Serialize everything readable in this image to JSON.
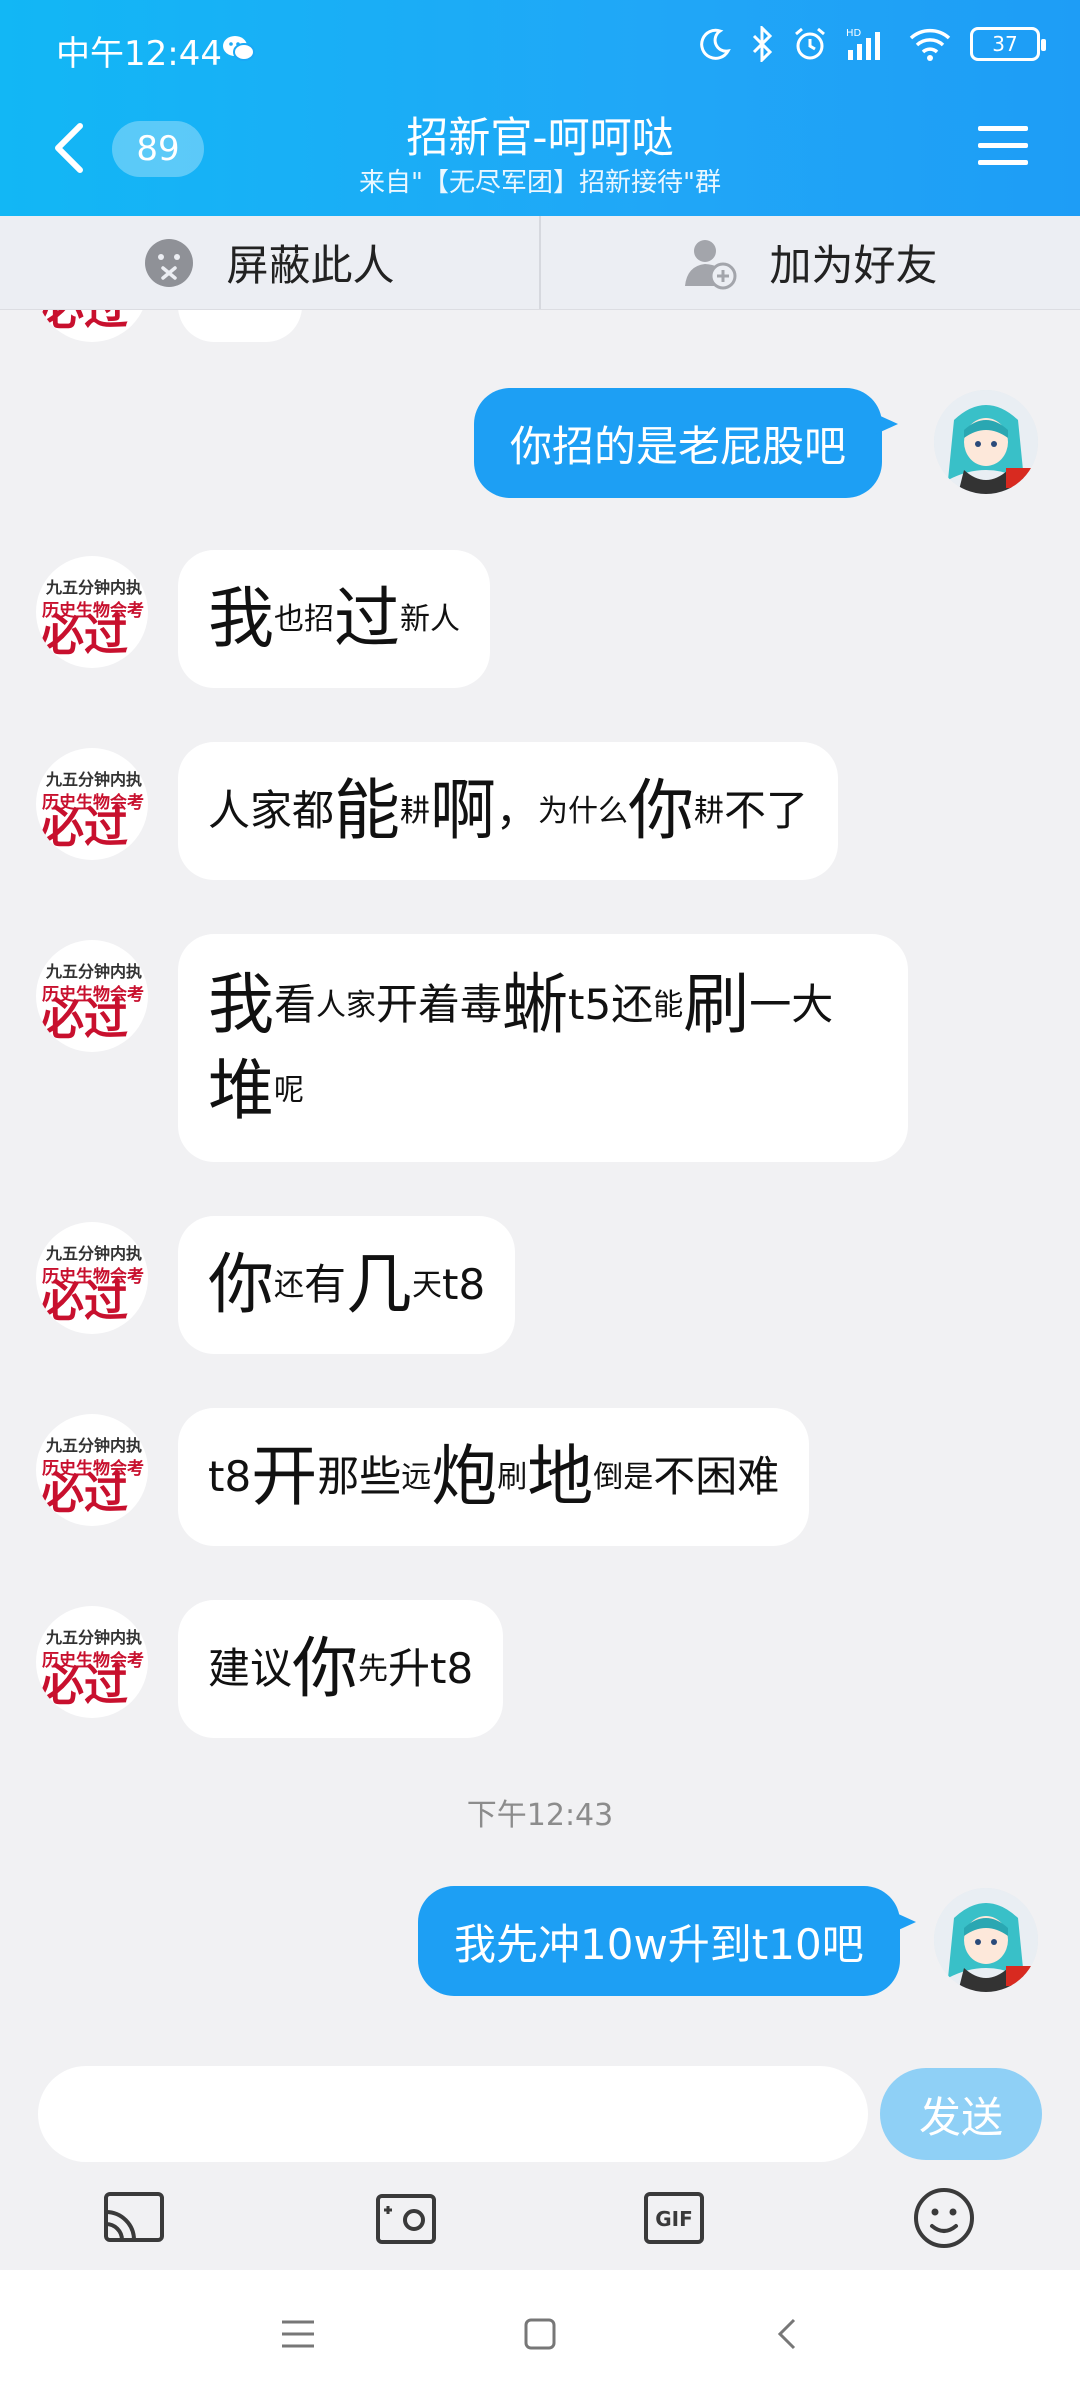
{
  "status_bar": {
    "time": "中午12:44",
    "battery": "37",
    "hd_label": "HD"
  },
  "header": {
    "unread_count": "89",
    "title": "招新官-呵呵哒",
    "subtitle": "来自\"【无尽军团】招新接待\"群"
  },
  "action_bar": {
    "block_label": "屏蔽此人",
    "add_friend_label": "加为好友"
  },
  "sender_avatar": {
    "line1": "九五分钟内执",
    "line2": "历史生物会考",
    "big": "必过"
  },
  "messages": [
    {
      "side": "out",
      "segments": [
        {
          "t": "你招的是老屁股吧",
          "s": "m"
        }
      ]
    },
    {
      "side": "in",
      "segments": [
        {
          "t": "我",
          "s": "b"
        },
        {
          "t": "也招",
          "s": "s"
        },
        {
          "t": "过",
          "s": "b"
        },
        {
          "t": "新人",
          "s": "s"
        }
      ]
    },
    {
      "side": "in",
      "segments": [
        {
          "t": "人家都",
          "s": "m"
        },
        {
          "t": "能",
          "s": "b"
        },
        {
          "t": "耕",
          "s": "s"
        },
        {
          "t": "啊",
          "s": "b"
        },
        {
          "t": "，",
          "s": "m"
        },
        {
          "t": "为什么",
          "s": "s"
        },
        {
          "t": "你",
          "s": "b"
        },
        {
          "t": "耕",
          "s": "s"
        },
        {
          "t": "不了",
          "s": "m"
        }
      ]
    },
    {
      "side": "in",
      "segments": [
        {
          "t": "我",
          "s": "b"
        },
        {
          "t": "看",
          "s": "m"
        },
        {
          "t": "人家",
          "s": "s"
        },
        {
          "t": "开着毒",
          "s": "m"
        },
        {
          "t": "蜥",
          "s": "b"
        },
        {
          "t": "t5还",
          "s": "m"
        },
        {
          "t": "能",
          "s": "s"
        },
        {
          "t": "刷",
          "s": "b"
        },
        {
          "t": "一大",
          "s": "m"
        },
        {
          "t": "堆",
          "s": "b"
        },
        {
          "t": "呢",
          "s": "s"
        }
      ]
    },
    {
      "side": "in",
      "segments": [
        {
          "t": "你",
          "s": "b"
        },
        {
          "t": "还",
          "s": "s"
        },
        {
          "t": "有",
          "s": "m"
        },
        {
          "t": "几",
          "s": "b"
        },
        {
          "t": "天",
          "s": "s"
        },
        {
          "t": "t8",
          "s": "m"
        }
      ]
    },
    {
      "side": "in",
      "segments": [
        {
          "t": "t8",
          "s": "m"
        },
        {
          "t": "开",
          "s": "b"
        },
        {
          "t": "那些",
          "s": "m"
        },
        {
          "t": "远",
          "s": "s"
        },
        {
          "t": "炮",
          "s": "b"
        },
        {
          "t": "刷",
          "s": "s"
        },
        {
          "t": "地",
          "s": "b"
        },
        {
          "t": "倒是",
          "s": "s"
        },
        {
          "t": "不困难",
          "s": "m"
        }
      ]
    },
    {
      "side": "in",
      "segments": [
        {
          "t": "建议",
          "s": "m"
        },
        {
          "t": "你",
          "s": "b"
        },
        {
          "t": "先",
          "s": "s"
        },
        {
          "t": "升t8",
          "s": "m"
        }
      ]
    },
    {
      "side": "time",
      "text": "下午12:43"
    },
    {
      "side": "out",
      "segments": [
        {
          "t": "我先冲10w升到t10吧",
          "s": "m"
        }
      ]
    }
  ],
  "input": {
    "placeholder": "",
    "send_label": "发送"
  },
  "toolbar": {
    "gif_label": "GIF"
  },
  "colors": {
    "header": "#12b7f5",
    "bubble_out": "#1d9ff4",
    "send_button": "#8fd0f6",
    "avatar_text": "#c8102e"
  }
}
